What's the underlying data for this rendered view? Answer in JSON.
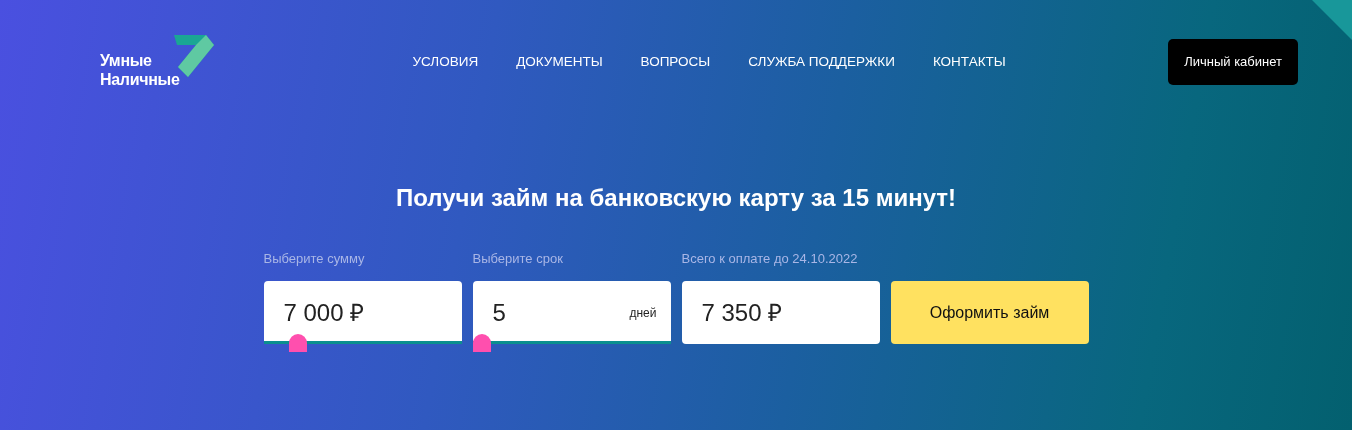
{
  "logo": {
    "line_1": "Умные",
    "line_2": "Наличные"
  },
  "nav": [
    "УСЛОВИЯ",
    "ДОКУМЕНТЫ",
    "ВОПРОСЫ",
    "СЛУЖБА ПОДДЕРЖКИ",
    "КОНТАКТЫ"
  ],
  "account_button": "Личный кабинет",
  "heading": "Получи займ на банковскую карту за 15 минут!",
  "fields": [
    {
      "kind": "slider",
      "label": "Выберите сумму",
      "value": "7 000 ₽",
      "level": 0.14
    },
    {
      "kind": "slider",
      "label": "Выберите срок",
      "value": "5",
      "unit": "дней",
      "level": 0
    },
    {
      "kind": "total",
      "label": "Всего к оплате до 24.10.2022",
      "value": "7 350 ₽"
    }
  ],
  "submit_button": "Оформить займ"
}
